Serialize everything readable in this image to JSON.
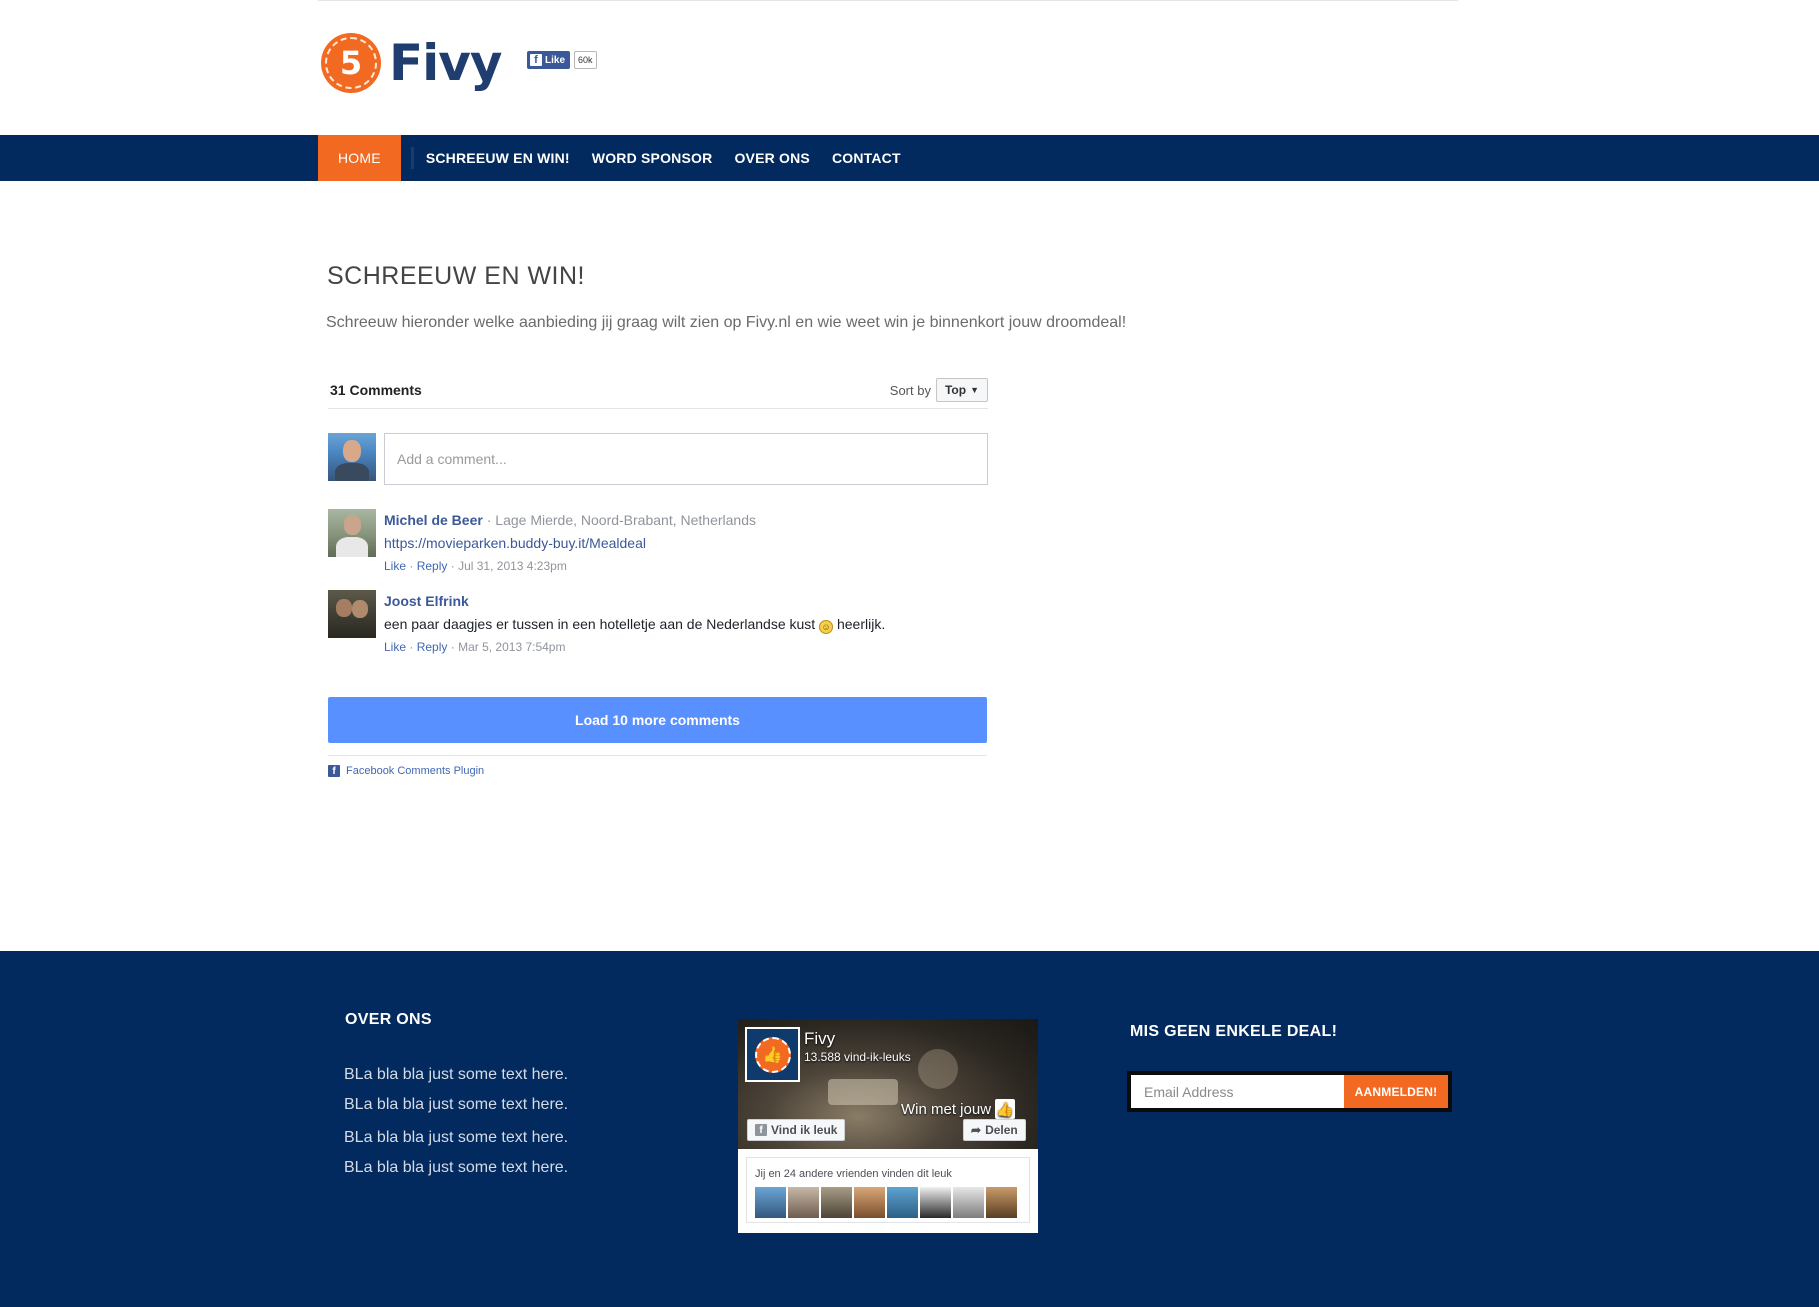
{
  "header": {
    "logo_number": "5",
    "logo_text": "Fivy",
    "fb_like_label": "Like",
    "fb_like_count": "60k"
  },
  "nav": {
    "items": [
      {
        "label": "HOME"
      },
      {
        "label": "SCHREEUW EN WIN!"
      },
      {
        "label": "WORD SPONSOR"
      },
      {
        "label": "OVER ONS"
      },
      {
        "label": "CONTACT"
      }
    ]
  },
  "main": {
    "title": "SCHREEUW EN WIN!",
    "intro": "Schreeuw hieronder welke aanbieding jij graag wilt zien op Fivy.nl en wie weet win je binnenkort jouw droomdeal!"
  },
  "comments": {
    "count_label": "31 Comments",
    "sort_label": "Sort by",
    "sort_value": "Top",
    "input_placeholder": "Add a comment...",
    "items": [
      {
        "author": "Michel de Beer",
        "location": "Lage Mierde, Noord-Brabant, Netherlands",
        "link": "https://movieparken.buddy-buy.it/Mealdeal",
        "like": "Like",
        "reply": "Reply",
        "date": "Jul 31, 2013 4:23pm"
      },
      {
        "author": "Joost Elfrink",
        "text_before": "een paar daagjes er tussen in een hotelletje aan de Nederlandse kust",
        "text_after": "heerlijk.",
        "like": "Like",
        "reply": "Reply",
        "date": "Mar 5, 2013 7:54pm"
      }
    ],
    "load_more": "Load 10 more comments",
    "plugin_label": "Facebook Comments Plugin"
  },
  "footer": {
    "about_title": "OVER ONS",
    "about_lines": [
      "BLa bla bla just some text here.",
      "BLa bla bla just some text here.",
      "BLa bla bla just some text here.",
      "BLa bla bla just some text here."
    ],
    "fb_box": {
      "page_name": "Fivy",
      "likes": "13.588 vind-ik-leuks",
      "cover_text": "Win met jouw",
      "like_button": "Vind ik leuk",
      "share_button": "Delen",
      "friends_text": "Jij en 24 andere vrienden vinden dit leuk"
    },
    "newsletter_title": "MIS GEEN ENKELE DEAL!",
    "email_placeholder": "Email Address",
    "subscribe_button": "AANMELDEN!"
  },
  "colors": {
    "navy": "#022a5e",
    "orange": "#f26a21",
    "fb_blue": "#3b5998",
    "load_more_blue": "#5890ff"
  }
}
